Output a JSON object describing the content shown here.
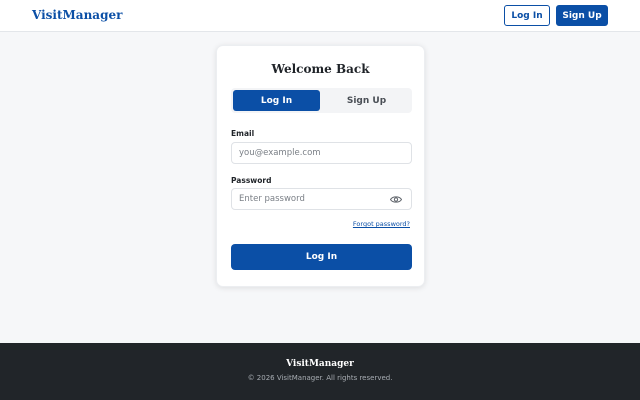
{
  "header": {
    "brand": "VisitManager",
    "login_label": "Log In",
    "signup_label": "Sign Up"
  },
  "card": {
    "title": "Welcome Back",
    "tabs": [
      {
        "label": "Log In",
        "active": true
      },
      {
        "label": "Sign Up",
        "active": false
      }
    ],
    "email": {
      "label": "Email",
      "placeholder": "you@example.com",
      "value": ""
    },
    "password": {
      "label": "Password",
      "placeholder": "Enter password",
      "value": ""
    },
    "forgot_label": "Forgot password?",
    "submit_label": "Log In"
  },
  "footer": {
    "brand": "VisitManager",
    "copyright": "© 2026 VisitManager. All rights reserved."
  },
  "icons": {
    "password_toggle": "eye-icon"
  },
  "colors": {
    "primary": "#0b4fa6",
    "background": "#f6f7f9",
    "footer": "#212529"
  }
}
